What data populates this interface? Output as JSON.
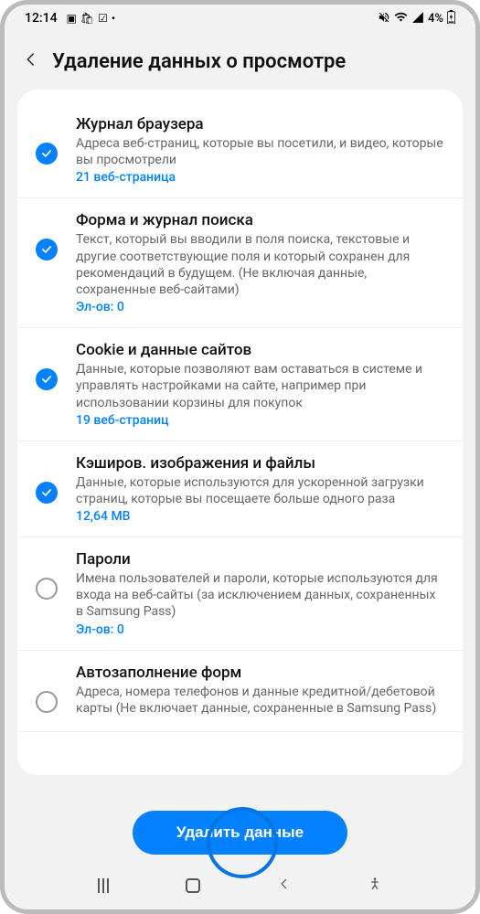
{
  "status": {
    "time": "12:14",
    "battery": "4%"
  },
  "header": {
    "title": "Удаление данных о просмотре"
  },
  "items": [
    {
      "checked": true,
      "title": "Журнал браузера",
      "desc": "Адреса веб-страниц, которые вы посетили, и видео, которые вы просмотрели",
      "count": "21 веб-страница"
    },
    {
      "checked": true,
      "title": "Форма и журнал поиска",
      "desc": "Текст, который вы вводили в поля поиска, текстовые и другие соответствующие поля и который сохранен для рекомендаций в будущем. (Не включая данные, сохраненные веб-сайтами)",
      "count": "Эл-ов: 0"
    },
    {
      "checked": true,
      "title": "Cookie и данные сайтов",
      "desc": "Данные, которые позволяют вам оставаться в системе и управлять настройками на сайте, например при использовании корзины для покупок",
      "count": "19 веб-страниц"
    },
    {
      "checked": true,
      "title": "Кэширов. изображения и файлы",
      "desc": "Данные, которые используются для ускоренной загрузки страниц, которые вы посещаете больше одного раза",
      "count": "12,64 MB"
    },
    {
      "checked": false,
      "title": "Пароли",
      "desc": "Имена пользователей и пароли, которые используются для входа на веб-сайты (за исключением данных, сохраненных в Samsung Pass)",
      "count": "Эл-ов: 0"
    },
    {
      "checked": false,
      "title": "Автозаполнение форм",
      "desc": "Адреса, номера телефонов и данные кредитной/дебетовой карты (Не включает данные, сохраненные в Samsung Pass)",
      "count": ""
    }
  ],
  "action": {
    "delete_label": "Удалить данные"
  }
}
